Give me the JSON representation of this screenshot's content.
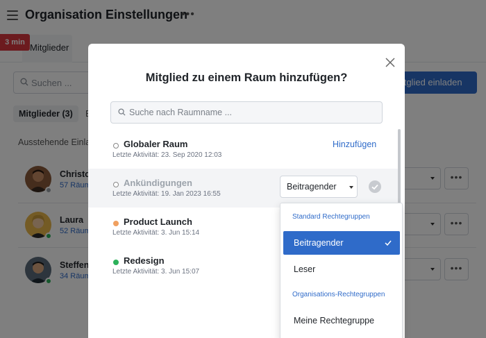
{
  "app": {
    "title": "Organisation Einstellungen",
    "timer": "3 min"
  },
  "tabs": [
    {
      "label": "Mitglieder",
      "active": true
    }
  ],
  "background": {
    "search_placeholder": "Suchen ...",
    "invite_button": "Mitglied einladen",
    "members_tab": "Mitglieder (3)",
    "pending_label": "Ausstehende Einlad",
    "members": [
      {
        "name": "Christo",
        "rooms": "57 Räum",
        "online_color": "#9aa0a6"
      },
      {
        "name": "Laura",
        "rooms": "52 Räum",
        "online_color": "#2cb15a"
      },
      {
        "name": "Steffen",
        "rooms": "34 Räum",
        "online_color": "#2cb15a"
      }
    ]
  },
  "modal": {
    "title": "Mitglied zu einem Raum hinzufügen?",
    "search_placeholder": "Suche nach Raumname ...",
    "rooms": [
      {
        "name": "Globaler Raum",
        "activity": "Letzte Aktivität: 23. Sep 2020 12:03",
        "action": "Hinzufügen",
        "status": "empty"
      },
      {
        "name": "Ankündigungen",
        "activity": "Letzte Aktivität: 19. Jan 2023 16:55",
        "role": "Beitragender",
        "status": "empty"
      },
      {
        "name": "Product Launch",
        "activity": "Letzte Aktivität: 3. Jun 15:14",
        "status": "#f0a060"
      },
      {
        "name": "Redesign",
        "activity": "Letzte Aktivität: 3. Jun 15:07",
        "status": "#2cb15a"
      }
    ]
  },
  "dropdown": {
    "group_standard": "Standard Rechtegruppen",
    "items_standard": [
      {
        "label": "Beitragender",
        "selected": true
      },
      {
        "label": "Leser",
        "selected": false
      }
    ],
    "group_org": "Organisations-Rechtegruppen",
    "items_org": [
      {
        "label": "Meine Rechtegruppe",
        "selected": false
      }
    ]
  },
  "colors": {
    "accent": "#2f6bc9",
    "badge": "#d9363e"
  }
}
